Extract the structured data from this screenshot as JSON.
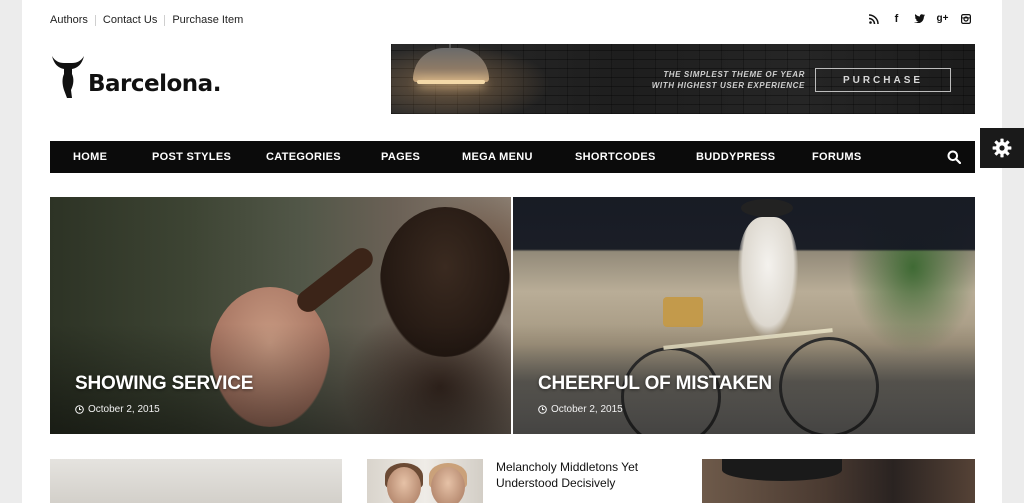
{
  "top_links": [
    "Authors",
    "Contact Us",
    "Purchase Item"
  ],
  "social_icons": [
    "rss-icon",
    "facebook-icon",
    "twitter-icon",
    "google-plus-icon",
    "instagram-icon"
  ],
  "logo": {
    "text": "Barcelona."
  },
  "banner": {
    "line1": "THE SIMPLEST THEME OF YEAR",
    "line2": "WITH HIGHEST USER EXPERIENCE",
    "button": "PURCHASE"
  },
  "nav": {
    "items": [
      "HOME",
      "POST STYLES",
      "CATEGORIES",
      "PAGES",
      "MEGA MENU",
      "SHORTCODES",
      "BUDDYPRESS",
      "FORUMS"
    ],
    "search_icon": "search-icon"
  },
  "settings_icon": "gear-icon",
  "hero": [
    {
      "title": "SHOWING SERVICE",
      "date": "October 2, 2015"
    },
    {
      "title": "CHEERFUL OF MISTAKEN",
      "date": "October 2, 2015"
    }
  ],
  "cards": [
    {
      "title": ""
    },
    {
      "title": "Melancholy Middletons Yet Understood Decisively"
    },
    {
      "title": ""
    }
  ]
}
